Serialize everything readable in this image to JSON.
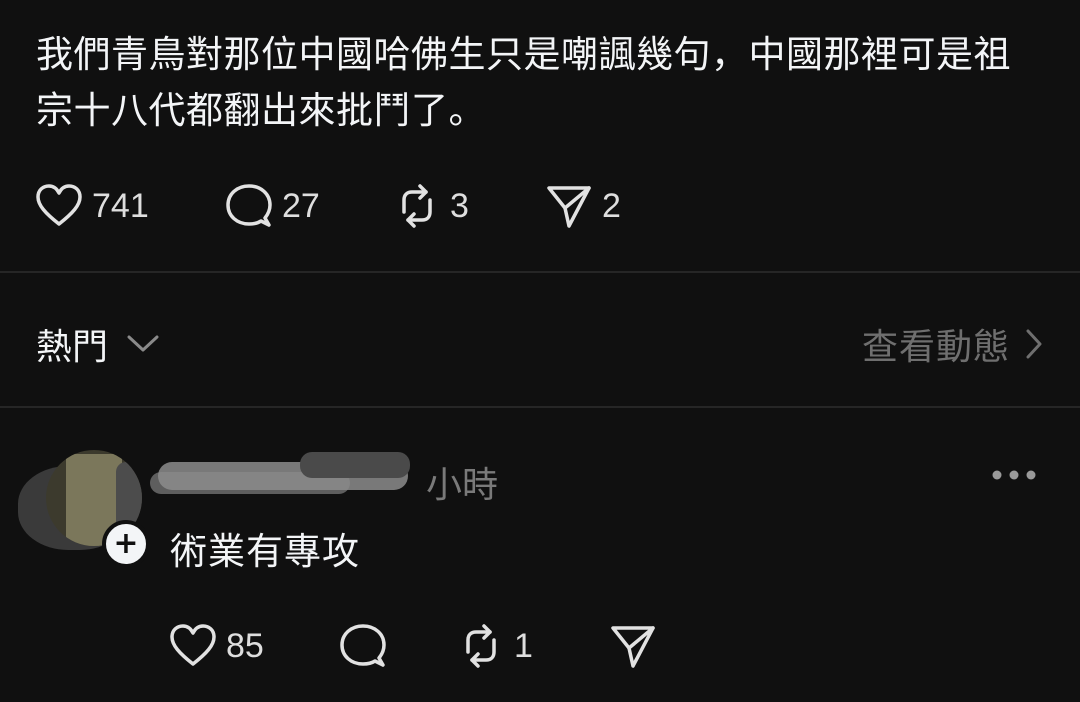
{
  "post": {
    "text": "我們青鳥對那位中國哈佛生只是嘲諷幾句，中國那裡可是祖宗十八代都翻出來批鬥了。",
    "likes": "741",
    "comments": "27",
    "reposts": "3",
    "shares": "2"
  },
  "sort_bar": {
    "sort_label": "熱門",
    "view_activity": "查看動態"
  },
  "reply": {
    "timestamp": "小時",
    "text": "術業有專攻",
    "likes": "85",
    "reposts": "1"
  },
  "icons": {
    "like": "heart-icon",
    "comment": "comment-bubble-icon",
    "repost": "repost-icon",
    "share": "send-icon",
    "more": "more-dots-icon",
    "sort_chevron": "chevron-down-icon",
    "activity_chevron": "chevron-right-icon",
    "follow": "plus-icon"
  },
  "colors": {
    "background": "#101010",
    "primary_text": "#f3f5f7",
    "secondary_text": "#7a7a7a",
    "divider": "#262626"
  }
}
